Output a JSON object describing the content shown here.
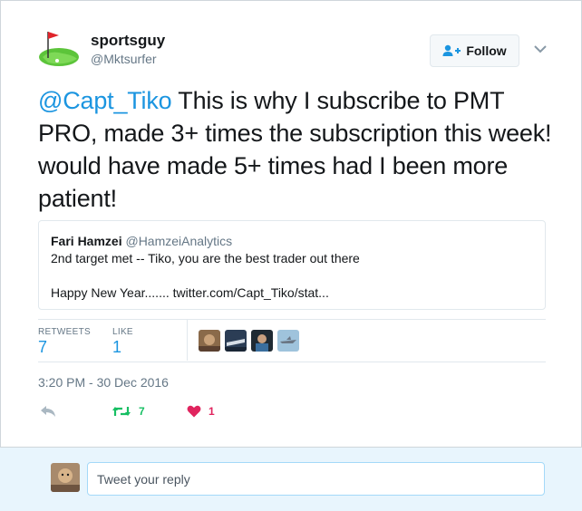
{
  "tweet": {
    "author": {
      "name": "sportsguy",
      "handle": "@Mktsurfer",
      "avatar_icon": "golf-flag-icon"
    },
    "follow_label": "Follow",
    "text_mention": "@Capt_Tiko",
    "text_body": " This is why I subscribe to PMT PRO, made 3+ times the subscription this week! would have made 5+ times had I been more patient!",
    "quote": {
      "name": "Fari Hamzei",
      "handle": "@HamzeiAnalytics",
      "line1": "2nd target met --  Tiko, you are the best trader out there",
      "line2": "Happy New Year....... twitter.com/Capt_Tiko/stat..."
    },
    "stats": {
      "retweets_label": "RETWEETS",
      "retweets": "7",
      "likes_label": "LIKE",
      "likes": "1"
    },
    "timestamp": "3:20 PM - 30 Dec 2016",
    "actions": {
      "retweet_count": "7",
      "like_count": "1"
    }
  },
  "reply": {
    "placeholder": "Tweet your reply"
  },
  "colors": {
    "accent": "#1b95e0",
    "retweet": "#17bf63",
    "like": "#e0245e",
    "muted": "#657786"
  }
}
